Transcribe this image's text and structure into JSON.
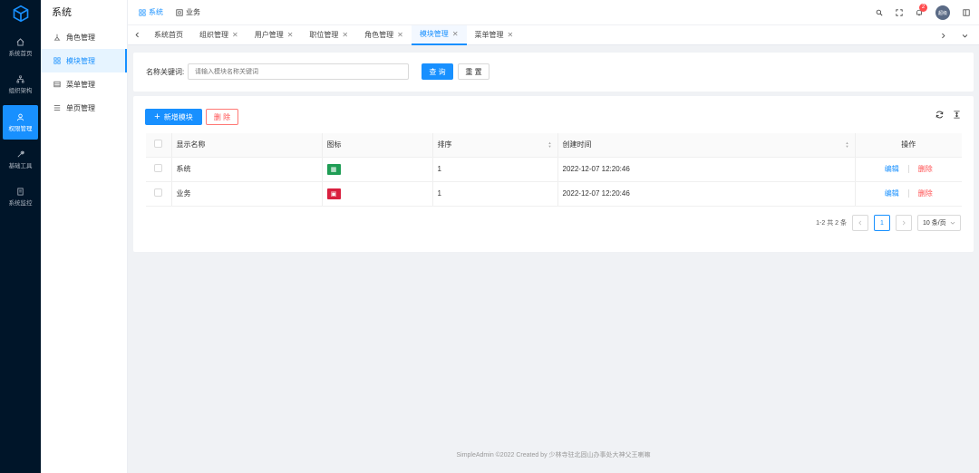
{
  "rail": {
    "items": [
      {
        "label": "系统首页",
        "icon": "home-icon"
      },
      {
        "label": "组织架构",
        "icon": "org-icon"
      },
      {
        "label": "权限管理",
        "icon": "user-icon",
        "active": true
      },
      {
        "label": "基础工具",
        "icon": "tool-icon"
      },
      {
        "label": "系统监控",
        "icon": "monitor-icon"
      }
    ]
  },
  "sidebar": {
    "title": "系统",
    "items": [
      {
        "label": "角色管理",
        "icon": "role-icon"
      },
      {
        "label": "模块管理",
        "icon": "module-icon",
        "active": true
      },
      {
        "label": "菜单管理",
        "icon": "menu-icon"
      },
      {
        "label": "单页管理",
        "icon": "page-icon"
      }
    ]
  },
  "topnav": {
    "items": [
      {
        "label": "系统",
        "active": true
      },
      {
        "label": "业务",
        "active": false
      }
    ],
    "notification_count": "2",
    "avatar_text": "超级"
  },
  "tabs": [
    {
      "label": "系统首页",
      "closable": false
    },
    {
      "label": "组织管理",
      "closable": true
    },
    {
      "label": "用户管理",
      "closable": true
    },
    {
      "label": "职位管理",
      "closable": true
    },
    {
      "label": "角色管理",
      "closable": true
    },
    {
      "label": "模块管理",
      "closable": true,
      "active": true
    },
    {
      "label": "菜单管理",
      "closable": true
    }
  ],
  "search": {
    "label": "名称关键词:",
    "placeholder": "请输入模块名称关键词",
    "query_button": "查 询",
    "reset_button": "重 置"
  },
  "toolbar": {
    "add_button": "新增模块",
    "delete_button": "删 除"
  },
  "table": {
    "columns": [
      "显示名称",
      "图标",
      "排序",
      "创建时间",
      "操作"
    ],
    "rows": [
      {
        "name": "系统",
        "icon_color": "#1f9d55",
        "order": "1",
        "created": "2022-12-07 12:20:46",
        "edit": "编辑",
        "delete": "删除"
      },
      {
        "name": "业务",
        "icon_color": "#d9203f",
        "order": "1",
        "created": "2022-12-07 12:20:46",
        "edit": "编辑",
        "delete": "删除"
      }
    ]
  },
  "pagination": {
    "summary": "1-2 共 2 条",
    "current_page": "1",
    "page_size": "10 条/页"
  },
  "footer": {
    "text": "SimpleAdmin ©2022 Created by 少林寺驻北固山办事处大神父王喇嘛"
  },
  "colors": {
    "primary": "#1890ff",
    "danger": "#ff4d4f",
    "rail_bg": "#001529"
  }
}
